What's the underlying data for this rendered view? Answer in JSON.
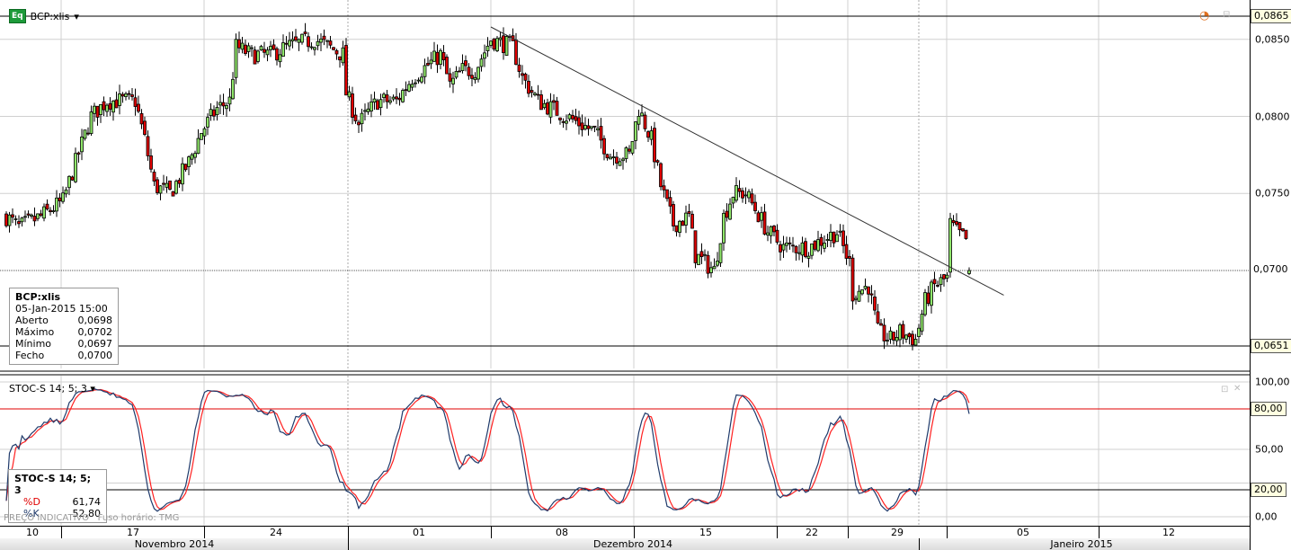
{
  "header": {
    "symbol": "BCP:xlis",
    "badge": "Eq"
  },
  "price_axis": {
    "labels": [
      "0,0850",
      "0,0800",
      "0,0750",
      "0,0700"
    ],
    "tag_top": "0,0865",
    "tag_current": "0,0700",
    "tag_support": "0,0651"
  },
  "ohlc_box": {
    "title": "BCP:xlis",
    "datetime": "05-Jan-2015 15:00",
    "rows": [
      {
        "label": "Aberto",
        "value": "0,0698"
      },
      {
        "label": "Máximo",
        "value": "0,0702"
      },
      {
        "label": "Mínimo",
        "value": "0,0697"
      },
      {
        "label": "Fecho",
        "value": "0,0700"
      }
    ]
  },
  "indicator": {
    "title": "STOC-S 14; 5; 3",
    "box_title": "STOC-S 14; 5; 3",
    "d_label": "%D",
    "d_value": "61,74",
    "k_label": "%K",
    "k_value": "52,80",
    "axis": [
      "100,00",
      "50,00",
      "0,00"
    ],
    "tag_high": "80,00",
    "tag_low": "20,00"
  },
  "footer": {
    "price_note": "PREÇO INDICATIVO",
    "timezone": "Fuso horário: TMG"
  },
  "time_axis": {
    "weeks": [
      "10",
      "17",
      "24",
      "01",
      "08",
      "15",
      "22",
      "29",
      "05",
      "12"
    ],
    "months": [
      "Novembro 2014",
      "Dezembro 2014",
      "Janeiro 2015"
    ]
  },
  "colors": {
    "up": "#8fe66a",
    "down": "#e00000",
    "k": "#1f3a6b",
    "d": "#ff2020"
  },
  "chart_data": {
    "type": "candlestick",
    "ylim": [
      0.064,
      0.087
    ],
    "close_path": [
      [
        0,
        0.0735
      ],
      [
        4,
        0.0728
      ],
      [
        11,
        0.0735
      ],
      [
        18,
        0.0745
      ],
      [
        22,
        0.077
      ],
      [
        27,
        0.08
      ],
      [
        32,
        0.081
      ],
      [
        41,
        0.081
      ],
      [
        44,
        0.0785
      ],
      [
        47,
        0.0755
      ],
      [
        52,
        0.075
      ],
      [
        58,
        0.077
      ],
      [
        62,
        0.079
      ],
      [
        67,
        0.0805
      ],
      [
        71,
        0.081
      ],
      [
        73,
        0.0845
      ],
      [
        78,
        0.084
      ],
      [
        84,
        0.084
      ],
      [
        89,
        0.0845
      ],
      [
        98,
        0.085
      ],
      [
        107,
        0.084
      ],
      [
        108,
        0.0815
      ],
      [
        112,
        0.0795
      ],
      [
        118,
        0.081
      ],
      [
        124,
        0.081
      ],
      [
        129,
        0.0825
      ],
      [
        138,
        0.084
      ],
      [
        141,
        0.082
      ],
      [
        145,
        0.083
      ],
      [
        149,
        0.083
      ],
      [
        154,
        0.085
      ],
      [
        161,
        0.0845
      ],
      [
        164,
        0.0825
      ],
      [
        169,
        0.081
      ],
      [
        178,
        0.08
      ],
      [
        187,
        0.079
      ],
      [
        192,
        0.0775
      ],
      [
        198,
        0.0775
      ],
      [
        201,
        0.0805
      ],
      [
        205,
        0.0785
      ],
      [
        208,
        0.0755
      ],
      [
        212,
        0.073
      ],
      [
        217,
        0.0735
      ],
      [
        219,
        0.071
      ],
      [
        225,
        0.07
      ],
      [
        228,
        0.0735
      ],
      [
        231,
        0.075
      ],
      [
        235,
        0.075
      ],
      [
        238,
        0.074
      ],
      [
        242,
        0.0725
      ],
      [
        247,
        0.0715
      ],
      [
        255,
        0.0715
      ],
      [
        264,
        0.0725
      ],
      [
        268,
        0.0705
      ],
      [
        269,
        0.0685
      ],
      [
        274,
        0.069
      ],
      [
        277,
        0.066
      ],
      [
        281,
        0.0655
      ],
      [
        284,
        0.066
      ],
      [
        289,
        0.0655
      ],
      [
        292,
        0.068
      ],
      [
        295,
        0.069
      ],
      [
        299,
        0.0695
      ],
      [
        300,
        0.073
      ],
      [
        302,
        0.0725
      ],
      [
        305,
        0.072
      ],
      [
        306,
        0.07
      ]
    ],
    "last_candle": {
      "open": 0.0698,
      "high": 0.0702,
      "low": 0.0697,
      "close": 0.07
    },
    "resistance": 0.0865,
    "support": 0.0651,
    "current": 0.07,
    "trendline": [
      [
        154,
        0.0858
      ],
      [
        317,
        0.0684
      ]
    ],
    "stochastic": {
      "k_period": 14,
      "slowing": 5,
      "d_period": 3,
      "levels": [
        80,
        20
      ]
    }
  }
}
